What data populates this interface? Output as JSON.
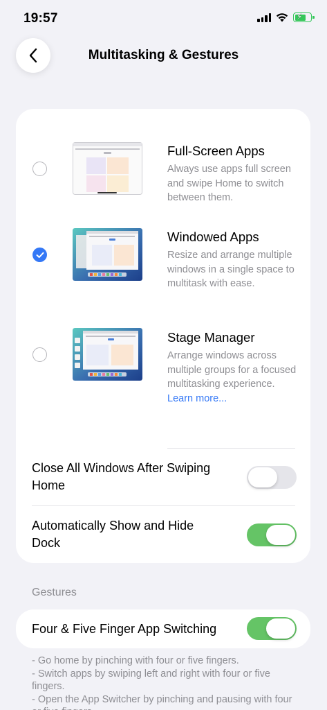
{
  "status_bar": {
    "time": "19:57"
  },
  "nav": {
    "title": "Multitasking & Gestures"
  },
  "modes": [
    {
      "title": "Full-Screen Apps",
      "description": "Always use apps full screen and swipe Home to switch between them.",
      "selected": false
    },
    {
      "title": "Windowed Apps",
      "description": "Resize and arrange multiple windows in a single space to multitask with ease.",
      "selected": true
    },
    {
      "title": "Stage Manager",
      "description": "Arrange windows across multiple groups for a focused multitasking experience.",
      "link": "Learn more...",
      "selected": false
    }
  ],
  "toggles": {
    "close_windows": {
      "label": "Close All Windows After Swiping Home",
      "on": false
    },
    "show_hide_dock": {
      "label": "Automatically Show and Hide Dock",
      "on": true
    }
  },
  "gestures": {
    "header": "Gestures",
    "four_five_finger": {
      "label": "Four & Five Finger App Switching",
      "on": true
    },
    "notes": [
      "- Go home by pinching with four or five fingers.",
      "- Switch apps by swiping left and right with four or five fingers.",
      "- Open the App Switcher by pinching and pausing with four or five fingers."
    ]
  },
  "colors": {
    "accent": "#3478f6",
    "toggle_on": "#65c466",
    "toggle_off": "#e5e5ea",
    "background": "#f2f2f7"
  }
}
